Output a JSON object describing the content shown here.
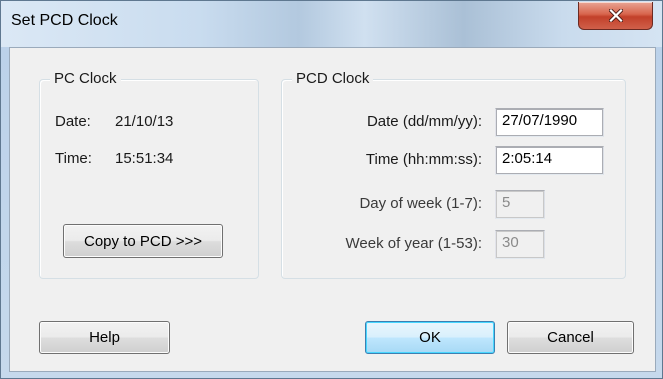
{
  "window": {
    "title": "Set PCD Clock",
    "close_icon": "close-icon"
  },
  "pc_clock": {
    "legend": "PC Clock",
    "date_label": "Date:",
    "date_value": "21/10/13",
    "time_label": "Time:",
    "time_value": "15:51:34",
    "copy_button": "Copy to PCD >>>"
  },
  "pcd_clock": {
    "legend": "PCD Clock",
    "date_label": "Date (dd/mm/yy):",
    "date_value": "27/07/1990",
    "time_label": "Time (hh:mm:ss):",
    "time_value": "2:05:14",
    "dow_label": "Day of week (1-7):",
    "dow_value": "5",
    "woy_label": "Week of year (1-53):",
    "woy_value": "30"
  },
  "buttons": {
    "help": "Help",
    "ok": "OK",
    "cancel": "Cancel"
  },
  "colors": {
    "close_button": "#c7432d",
    "default_button_border": "#3c7fb1"
  }
}
